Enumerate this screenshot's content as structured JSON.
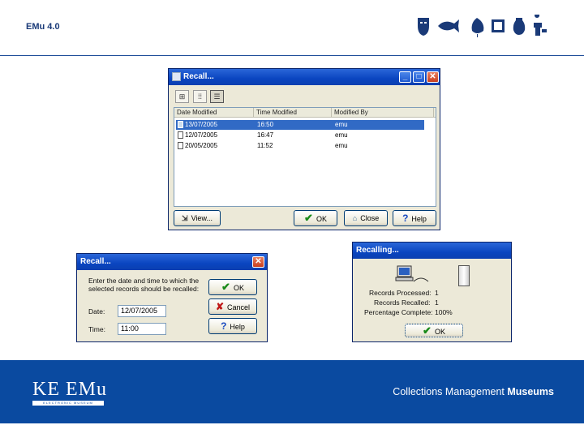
{
  "header": {
    "title": "EMu 4.0",
    "icons": [
      "mask-icon",
      "fish-icon",
      "leaf-icon",
      "frame-icon",
      "vase-icon",
      "figure-icon"
    ]
  },
  "footer": {
    "logo_text": "KE EMu",
    "logo_subtext": "ELECTRONIC MUSEUM",
    "tagline_regular": "Collections Management ",
    "tagline_bold": "Museums",
    "band_color": "#0a4aa0"
  },
  "recall_list_dialog": {
    "title": "Recall...",
    "columns": [
      "Date Modified",
      "Time Modified",
      "Modified By"
    ],
    "rows": [
      {
        "date": "13/07/2005",
        "time": "16:50",
        "by": "emu",
        "selected": true
      },
      {
        "date": "12/07/2005",
        "time": "16:47",
        "by": "emu",
        "selected": false
      },
      {
        "date": "20/05/2005",
        "time": "11:52",
        "by": "emu",
        "selected": false
      }
    ],
    "buttons": {
      "view": "View...",
      "ok": "OK",
      "close": "Close",
      "help": "Help"
    }
  },
  "recall_date_dialog": {
    "title": "Recall...",
    "prompt": "Enter the date and time to which the selected records should be recalled:",
    "date_label": "Date:",
    "date_value": "12/07/2005",
    "time_label": "Time:",
    "time_value": "11:00",
    "buttons": {
      "ok": "OK",
      "cancel": "Cancel",
      "help": "Help"
    }
  },
  "recalling_dialog": {
    "title": "Recalling...",
    "records_processed_label": "Records Processed:",
    "records_processed_value": "1",
    "records_recalled_label": "Records Recalled:",
    "records_recalled_value": "1",
    "percentage_label": "Percentage Complete:",
    "percentage_value": "100%",
    "ok": "OK"
  }
}
